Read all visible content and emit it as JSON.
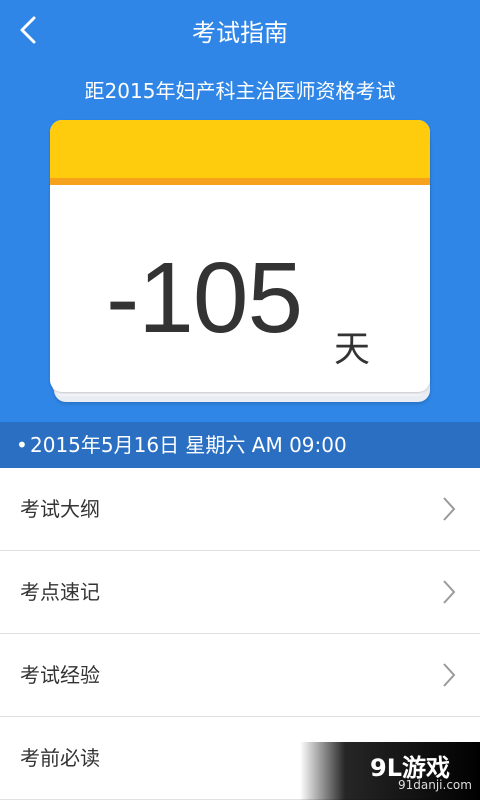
{
  "header": {
    "title": "考试指南",
    "back_icon": "chevron-left-icon"
  },
  "exam": {
    "subtitle": "距2015年妇产科主治医师资格考试",
    "days": "-105",
    "unit": "天",
    "date_bullet": "•",
    "date_text": "2015年5月16日 星期六 AM 09:00"
  },
  "menu": {
    "items": [
      {
        "label": "考试大纲"
      },
      {
        "label": "考点速记"
      },
      {
        "label": "考试经验"
      },
      {
        "label": "考前必读"
      }
    ]
  },
  "watermark": {
    "brand": "9L游戏",
    "url": "91danji.com"
  },
  "colors": {
    "primary": "#2f86e6",
    "date_bar": "#2a6fc2",
    "calendar_top": "#ffcc0d",
    "calendar_line": "#f6a21c"
  }
}
